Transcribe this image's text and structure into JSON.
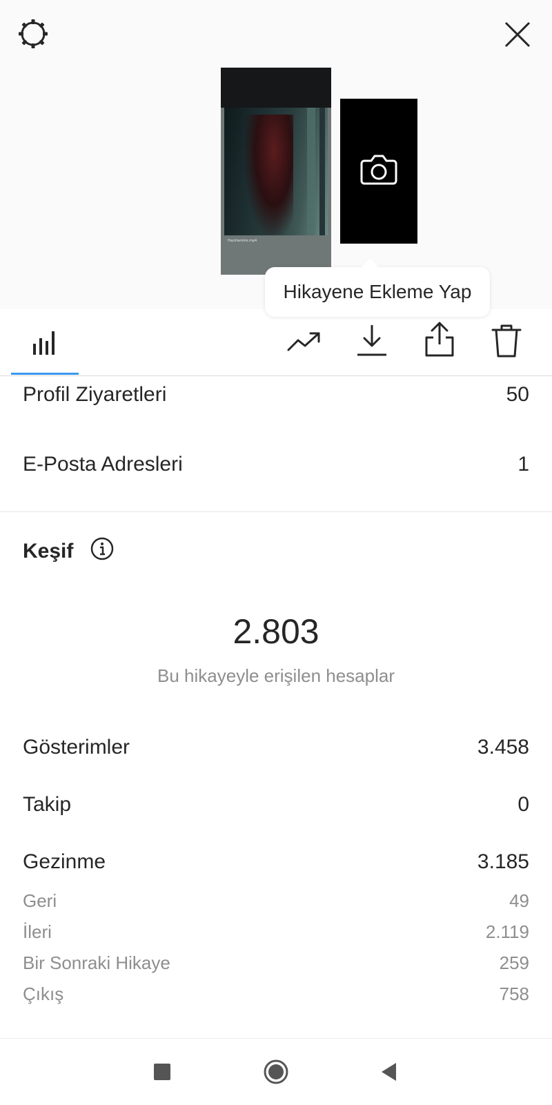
{
  "header": {
    "settings_icon": "gear-icon",
    "close_icon": "close-icon"
  },
  "story": {
    "caption": "Hazirlanmis.mp4",
    "next_icon": "camera-icon"
  },
  "tooltip": {
    "text": "Hikayene Ekleme Yap"
  },
  "toolbar": {
    "tabs": [
      {
        "icon": "bar-chart-icon",
        "active": true
      }
    ],
    "actions": [
      {
        "icon": "trending-icon"
      },
      {
        "icon": "download-icon"
      },
      {
        "icon": "share-icon"
      },
      {
        "icon": "trash-icon"
      }
    ],
    "accent_color": "#3897f0"
  },
  "interactions": {
    "rows": [
      {
        "label": "Profil Ziyaretleri",
        "value": "50"
      },
      {
        "label": "E-Posta Adresleri",
        "value": "1"
      }
    ]
  },
  "discovery": {
    "title": "Keşif",
    "info_icon": "info-icon",
    "reach_value": "2.803",
    "reach_caption": "Bu hikayeyle erişilen hesaplar",
    "rows": [
      {
        "label": "Gösterimler",
        "value": "3.458"
      },
      {
        "label": "Takip",
        "value": "0"
      },
      {
        "label": "Gezinme",
        "value": "3.185"
      }
    ],
    "navigation_breakdown": [
      {
        "label": "Geri",
        "value": "49"
      },
      {
        "label": "İleri",
        "value": "2.119"
      },
      {
        "label": "Bir Sonraki Hikaye",
        "value": "259"
      },
      {
        "label": "Çıkış",
        "value": "758"
      }
    ]
  },
  "system_nav": {
    "buttons": [
      "recents-square-icon",
      "home-circle-icon",
      "back-triangle-icon"
    ]
  }
}
